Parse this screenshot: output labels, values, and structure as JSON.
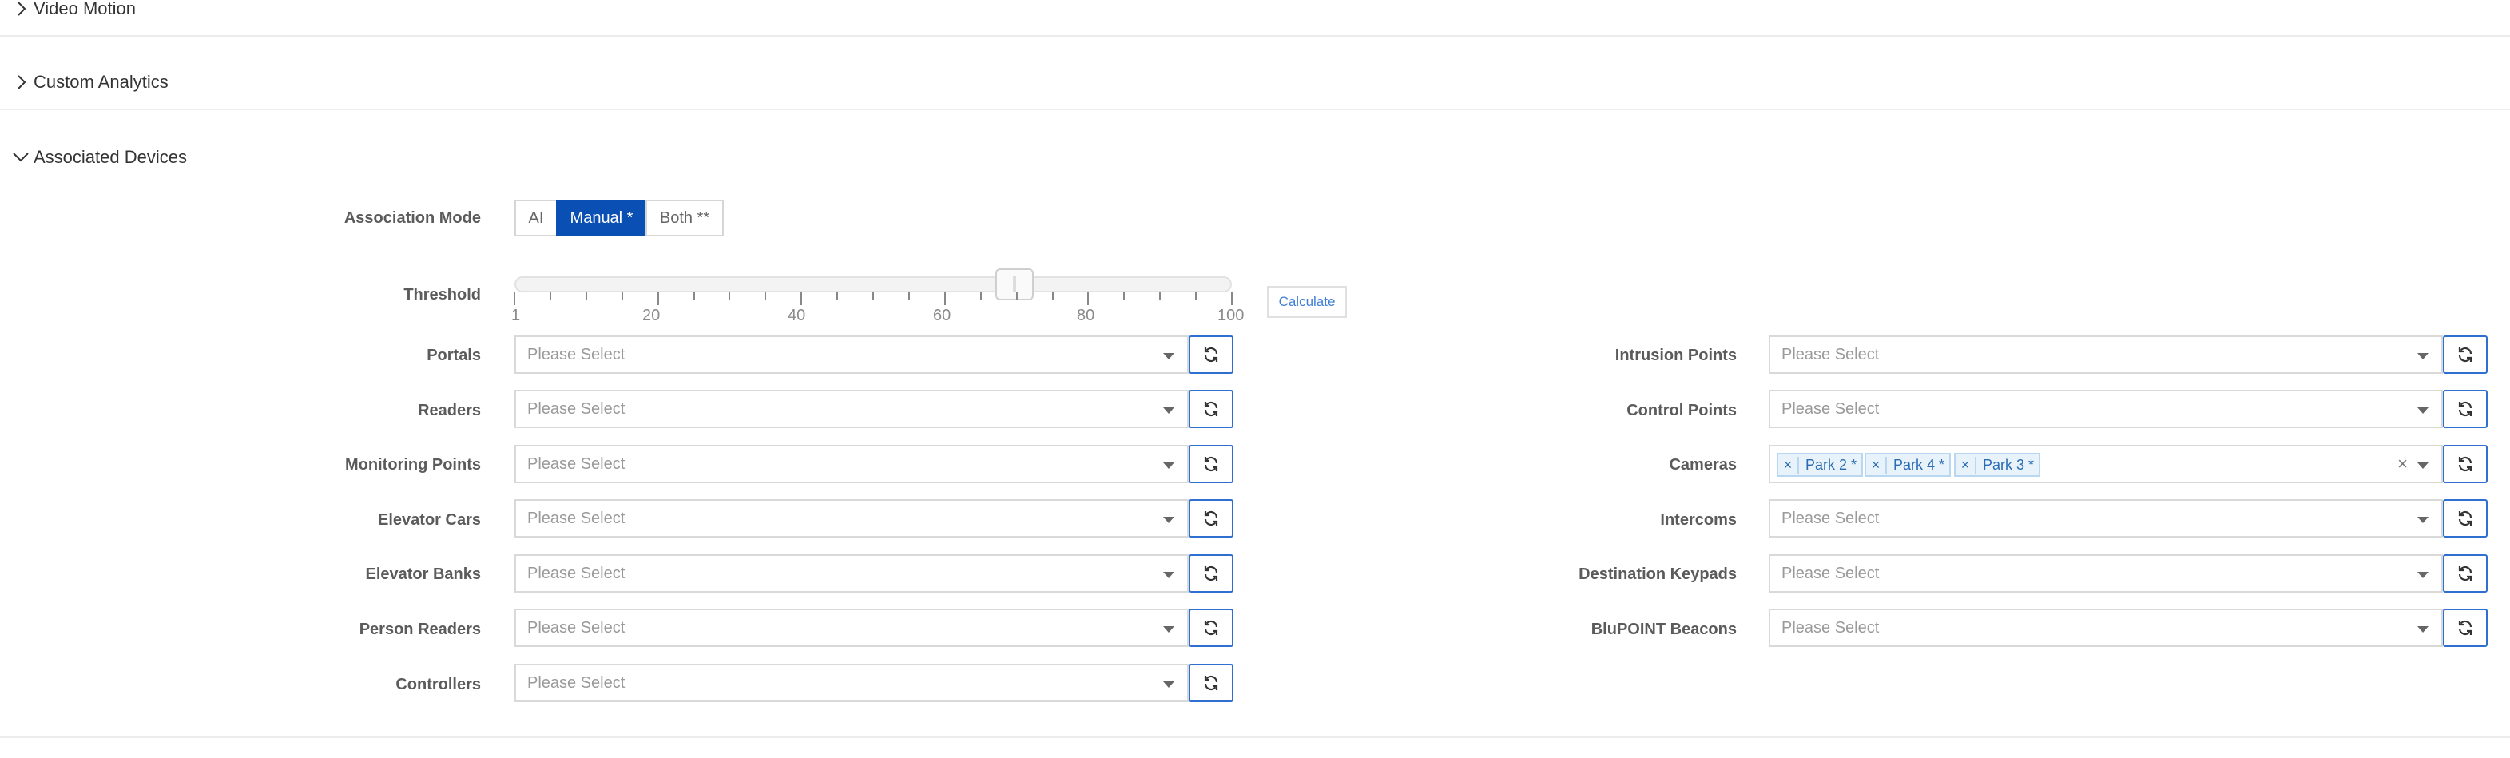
{
  "sections": {
    "video_motion": "Video Motion",
    "custom_analytics": "Custom Analytics",
    "associated_devices": "Associated Devices"
  },
  "association_mode": {
    "label": "Association Mode",
    "options": [
      "AI",
      "Manual *",
      "Both **"
    ],
    "selected": "Manual *"
  },
  "threshold": {
    "label": "Threshold",
    "min": 1,
    "max": 100,
    "value": 70,
    "tick_labels": [
      "1",
      "20",
      "40",
      "60",
      "80",
      "100"
    ],
    "calculate_label": "Calculate"
  },
  "placeholder": "Please Select",
  "left_fields": [
    {
      "label": "Portals"
    },
    {
      "label": "Readers"
    },
    {
      "label": "Monitoring Points"
    },
    {
      "label": "Elevator Cars"
    },
    {
      "label": "Elevator Banks"
    },
    {
      "label": "Person Readers"
    },
    {
      "label": "Controllers"
    }
  ],
  "right_fields": [
    {
      "label": "Intrusion Points"
    },
    {
      "label": "Control Points"
    },
    {
      "label": "Cameras",
      "tags": [
        "Park 2 *",
        "Park 4 *",
        "Park 3 *"
      ]
    },
    {
      "label": "Intercoms"
    },
    {
      "label": "Destination Keypads"
    },
    {
      "label": "BluPOINT Beacons"
    }
  ],
  "icons": {
    "collapsed": "chevron-right-icon",
    "expanded": "chevron-down-icon",
    "refresh": "refresh-icon",
    "dropdown": "caret-down-icon",
    "remove": "close-icon"
  },
  "colors": {
    "accent": "#0a4fb3",
    "refresh_border": "#2f6fd0",
    "tag_bg": "#e7f2fb"
  }
}
